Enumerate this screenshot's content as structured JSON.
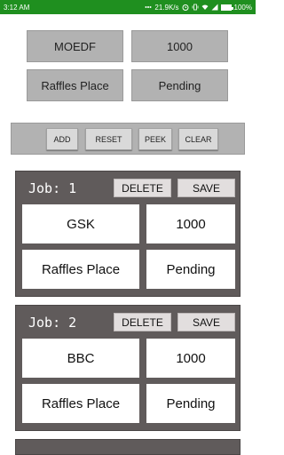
{
  "status_bar": {
    "time": "3:12 AM",
    "network_speed": "21.9K/s",
    "battery": "100%",
    "battery_level": 1.0,
    "icons": [
      "dots-icon",
      "alarm-icon",
      "vibrate-icon",
      "wifi-icon",
      "signal-icon",
      "battery-icon"
    ]
  },
  "form": {
    "name": "MOEDF",
    "amount": "1000",
    "location": "Raffles Place",
    "status": "Pending"
  },
  "actions": {
    "add": "ADD",
    "reset": "RESET",
    "peek": "PEEK",
    "clear": "CLEAR"
  },
  "jobs": [
    {
      "title": "Job:  1",
      "delete_label": "DELETE",
      "save_label": "SAVE",
      "name": "GSK",
      "amount": "1000",
      "location": "Raffles Place",
      "status": "Pending"
    },
    {
      "title": "Job:  2",
      "delete_label": "DELETE",
      "save_label": "SAVE",
      "name": "BBC",
      "amount": "1000",
      "location": "Raffles Place",
      "status": "Pending"
    }
  ]
}
